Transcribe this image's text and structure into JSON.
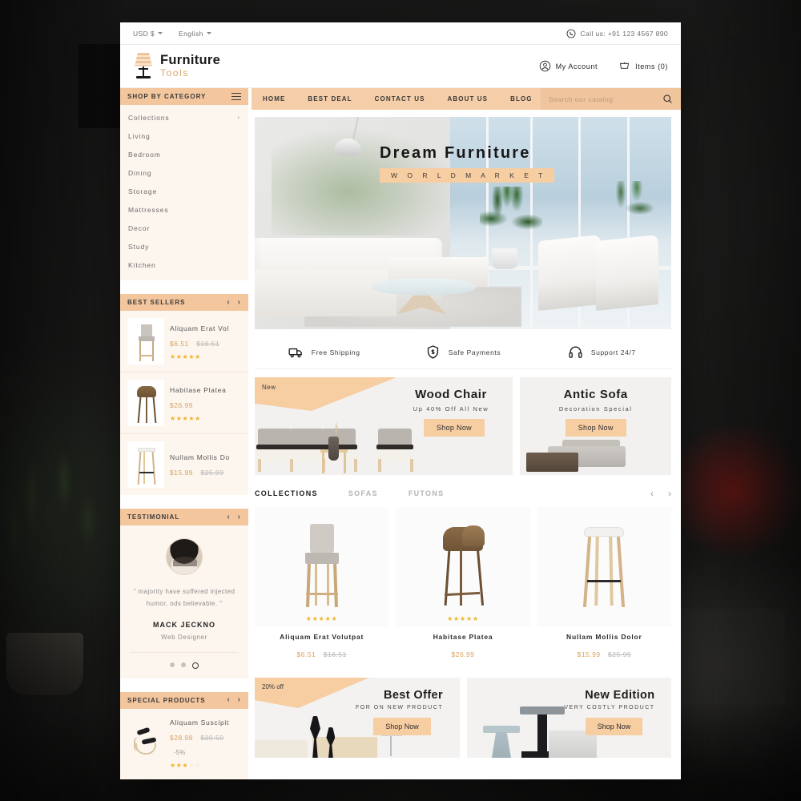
{
  "topbar": {
    "currency": "USD $",
    "language": "English",
    "call_label": "Call us: +91 123 4567 890",
    "phone_icon": "phone-icon"
  },
  "header": {
    "brand_line1": "Furniture",
    "brand_line2": "Tools",
    "logo_icon": "lamp-icon",
    "account_label": "My Account",
    "account_icon": "user-circle-icon",
    "cart_label": "Items (0)",
    "cart_icon": "shopping-cart-icon"
  },
  "nav": {
    "items": [
      "HOME",
      "BEST DEAL",
      "CONTACT US",
      "ABOUT US",
      "BLOG"
    ],
    "search_placeholder": "Search our catalog",
    "search_value": "",
    "search_icon": "search-icon"
  },
  "sidebar": {
    "category_widget": {
      "title": "SHOP BY CATEGORY",
      "menu_icon": "hamburger-icon",
      "items": [
        {
          "label": "Collections",
          "has_children": true
        },
        {
          "label": "Living",
          "has_children": false
        },
        {
          "label": "Bedroom",
          "has_children": false
        },
        {
          "label": "Dining",
          "has_children": false
        },
        {
          "label": "Storage",
          "has_children": false
        },
        {
          "label": "Mattresses",
          "has_children": false
        },
        {
          "label": "Decor",
          "has_children": false
        },
        {
          "label": "Study",
          "has_children": false
        },
        {
          "label": "Kitchen",
          "has_children": false
        }
      ]
    },
    "best_sellers": {
      "title": "BEST SELLERS",
      "prev_icon": "chevron-left-icon",
      "next_icon": "chevron-right-icon",
      "products": [
        {
          "name": "Aliquam Erat Vol",
          "price": "$6.51",
          "old_price": "$16.51",
          "stars": 5,
          "thumb": "bar-stool-grey-thumb"
        },
        {
          "name": "Habitase Platea",
          "price": "$26.99",
          "old_price": "",
          "stars": 5,
          "thumb": "wood-stool-thumb"
        },
        {
          "name": "Nullam Mollis Do",
          "price": "$15.99",
          "old_price": "$25.99",
          "stars": 0,
          "thumb": "white-stool-thumb"
        }
      ]
    },
    "testimonial": {
      "title": "TESTIMONIAL",
      "prev_icon": "chevron-left-icon",
      "next_icon": "chevron-right-icon",
      "avatar": "avatar",
      "quote": "\" majority have suffered injected humor, ods believable. \"",
      "author": "MACK JECKNO",
      "role": "Web Designer",
      "dots": 3,
      "active_dot": 3
    },
    "special_products": {
      "title": "SPECIAL PRODUCTS",
      "prev_icon": "chevron-left-icon",
      "next_icon": "chevron-right-icon",
      "products": [
        {
          "name": "Aliquam Suscipit",
          "price": "$28.98",
          "old_price": "$30.50",
          "discount": "-5%",
          "stars": 3,
          "thumb": "lounge-chair-thumb"
        }
      ]
    }
  },
  "hero": {
    "title": "Dream Furniture",
    "subtitle": "W O R L D   M A R K E T"
  },
  "services": [
    {
      "label": "Free Shipping",
      "icon": "truck-icon"
    },
    {
      "label": "Safe Payments",
      "icon": "shield-dollar-icon"
    },
    {
      "label": "Support 24/7",
      "icon": "headphones-icon"
    }
  ],
  "promos": [
    {
      "tag": "New",
      "title": "Wood Chair",
      "subtitle": "Up 40% Off All New",
      "button": "Shop Now"
    },
    {
      "tag": "",
      "title": "Antic Sofa",
      "subtitle": "Decoration Special",
      "button": "Shop Now"
    }
  ],
  "collections": {
    "tabs": [
      {
        "label": "COLLECTIONS",
        "active": true
      },
      {
        "label": "SOFAS",
        "active": false
      },
      {
        "label": "FUTONS",
        "active": false
      }
    ],
    "prev_icon": "chevron-left-icon",
    "next_icon": "chevron-right-icon",
    "products": [
      {
        "name": "Aliquam Erat Volutpat",
        "price": "$6.51",
        "old_price": "$16.51",
        "stars": 5,
        "image": "grey-bar-stool"
      },
      {
        "name": "Habitase Platea",
        "price": "$26.99",
        "old_price": "",
        "stars": 5,
        "image": "wood-shell-stool"
      },
      {
        "name": "Nullam Mollis Dolor",
        "price": "$15.99",
        "old_price": "$25.99",
        "stars": 0,
        "image": "white-wood-stool"
      }
    ]
  },
  "bottom_promos": [
    {
      "tag": "20% off",
      "title": "Best Offer",
      "subtitle": "FOR ON NEW PRODUCT",
      "button": "Shop Now"
    },
    {
      "tag": "",
      "title": "New Edition",
      "subtitle": "VERY COSTLY PRODUCT",
      "button": "Shop Now"
    }
  ],
  "colors": {
    "accent": "#f3c69e",
    "accent_light": "#f7cda2",
    "sidebar_bg": "#fdf6ef",
    "price": "#d9a15f",
    "star": "#f0b429",
    "backdrop": "#1b1b1b"
  }
}
